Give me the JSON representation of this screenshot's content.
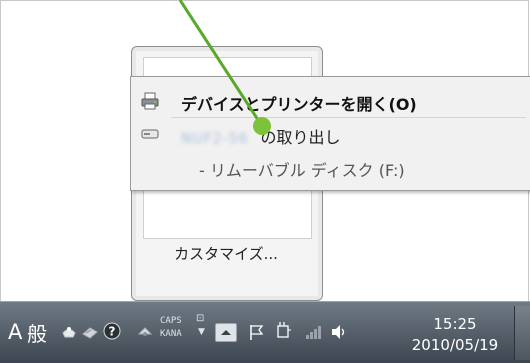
{
  "tray_panel": {
    "customize_label": "カスタマイズ..."
  },
  "context_menu": {
    "items": [
      {
        "label": "デバイスとプリンターを開く(O)",
        "icon": "printer-icon"
      },
      {
        "label_suffix": "の取り出し",
        "device_name": "NUF2-56",
        "icon": "usb-drive-icon"
      },
      {
        "label": "- リムーバブル ディスク (F:)"
      }
    ]
  },
  "taskbar": {
    "ime_mode": "A",
    "ime_kanji": "般",
    "caps_text": "CAPS",
    "kana_text": "KANA",
    "time": "15:25",
    "date": "2010/05/19"
  },
  "colors": {
    "annotation": "#7cc33a",
    "annotation_line": "#5aa82a",
    "taskbar_top": "#707a84",
    "taskbar_bottom": "#3d4650",
    "menu_bg": "#f1f1f1"
  }
}
